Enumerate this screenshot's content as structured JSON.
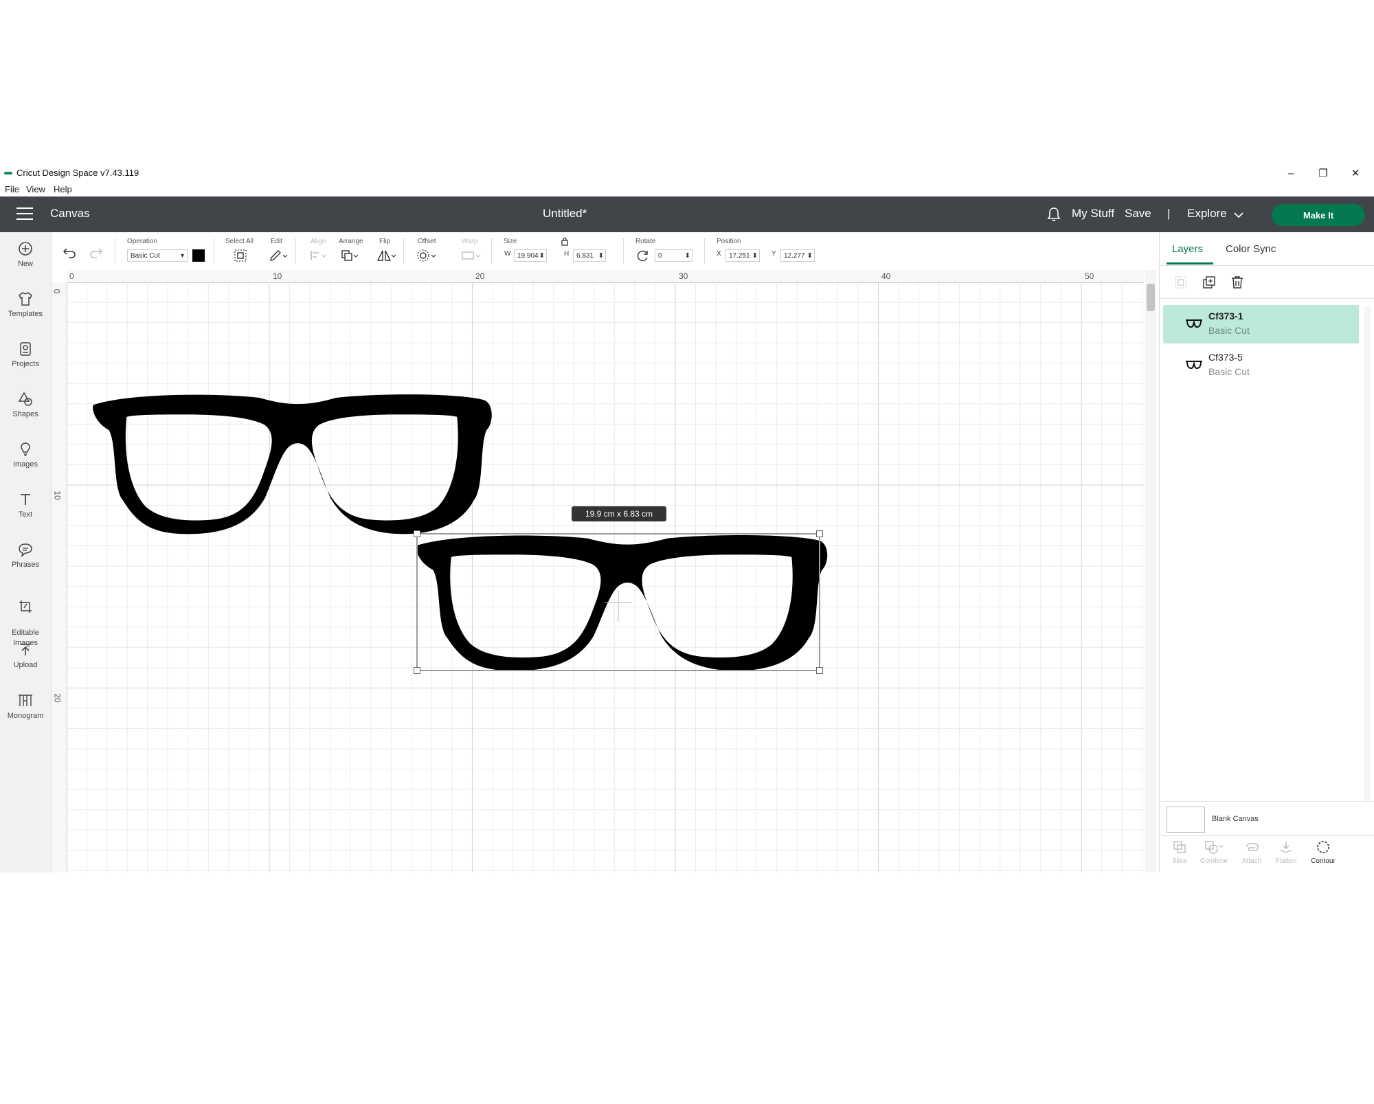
{
  "window": {
    "title": "Cricut Design Space  v7.43.119",
    "controls": [
      "–",
      "❐",
      "✕"
    ]
  },
  "menu": [
    "File",
    "View",
    "Help"
  ],
  "header": {
    "canvas_label": "Canvas",
    "doc_title": "Untitled*",
    "my_stuff": "My Stuff",
    "save": "Save",
    "divider": "|",
    "explore": "Explore",
    "make_it": "Make It",
    "accent_color": "#04784e",
    "bar_color": "#414549"
  },
  "sidebar": [
    {
      "label": "New",
      "icon": "plus-circle-icon"
    },
    {
      "label": "Templates",
      "icon": "shirt-icon"
    },
    {
      "label": "Projects",
      "icon": "projects-icon"
    },
    {
      "label": "Shapes",
      "icon": "shapes-icon"
    },
    {
      "label": "Images",
      "icon": "lightbulb-icon"
    },
    {
      "label": "Text",
      "icon": "text-icon"
    },
    {
      "label": "Phrases",
      "icon": "speech-bubble-icon"
    },
    {
      "label": "Editable\nImages",
      "icon": "editable-image-icon"
    },
    {
      "label": "Upload",
      "icon": "upload-icon"
    },
    {
      "label": "Monogram",
      "icon": "monogram-icon"
    }
  ],
  "toolbar": {
    "operation_label": "Operation",
    "operation_value": "Basic Cut",
    "select_all_label": "Select All",
    "edit_label": "Edit",
    "align_label": "Align",
    "arrange_label": "Arrange",
    "flip_label": "Flip",
    "offset_label": "Offset",
    "warp_label": "Warp",
    "size_label": "Size",
    "w_label": "W",
    "w_value": "19.904",
    "h_label": "H",
    "h_value": "6.831",
    "rotate_label": "Rotate",
    "rotate_value": "0",
    "position_label": "Position",
    "x_label": "X",
    "x_value": "17.251",
    "y_label": "Y",
    "y_value": "12.277"
  },
  "rulers": {
    "horizontal": [
      "0",
      "10",
      "20",
      "30",
      "40",
      "50"
    ],
    "vertical": [
      "0",
      "10",
      "20"
    ]
  },
  "canvas": {
    "size_tooltip": "19.9  cm x 6.83  cm"
  },
  "panel": {
    "tabs": [
      "Layers",
      "Color Sync"
    ],
    "active_tab_color": "#04784e",
    "layers": [
      {
        "name": "Cf373-1",
        "op": "Basic Cut",
        "selected": true
      },
      {
        "name": "Cf373-5",
        "op": "Basic Cut",
        "selected": false
      }
    ],
    "selected_row_color": "#bde9d9",
    "blank_canvas": "Blank Canvas",
    "bottom_tools": [
      "Slice",
      "Combine",
      "Attach",
      "Flatten",
      "Contour"
    ]
  }
}
